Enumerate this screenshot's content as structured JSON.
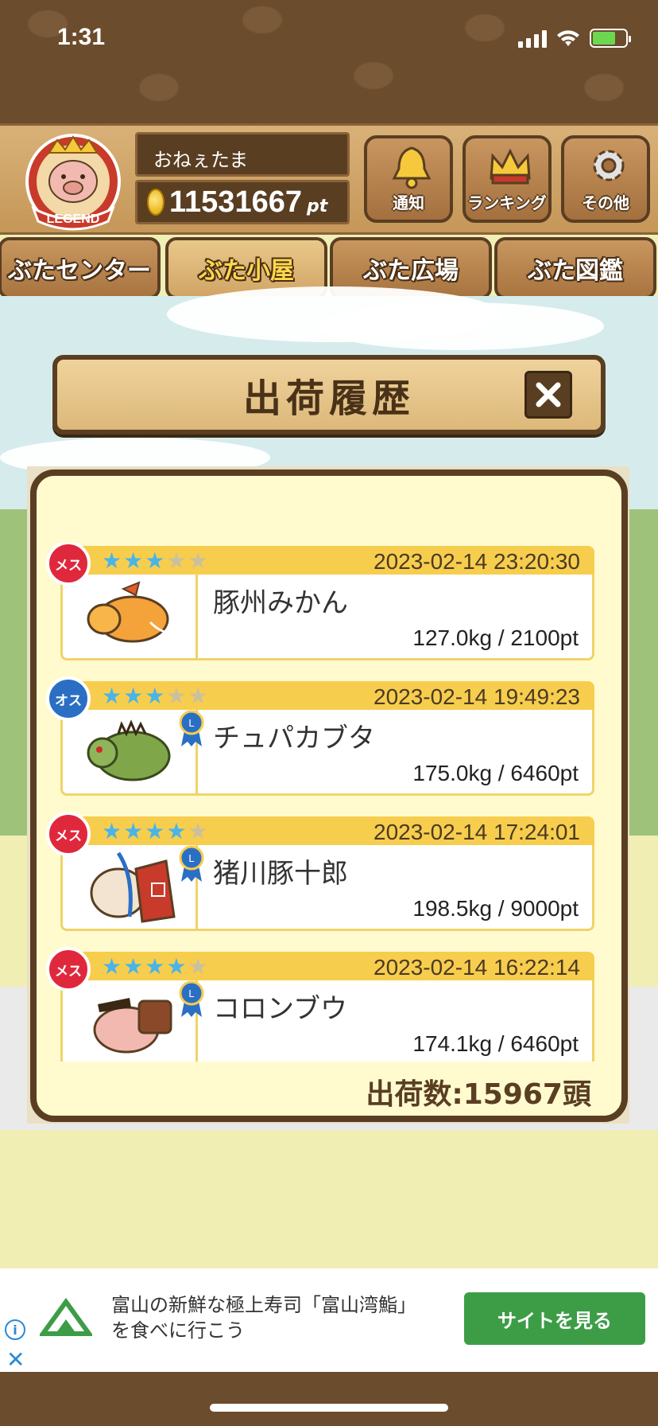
{
  "status": {
    "time": "1:31"
  },
  "player": {
    "name": "おねぇたま",
    "points": "11531667",
    "points_unit": "pt",
    "badge_text": "LEGEND"
  },
  "top_buttons": {
    "notice": "通知",
    "ranking": "ランキング",
    "other": "その他"
  },
  "tabs": [
    {
      "label": "ぶたセンター",
      "active": false
    },
    {
      "label": "ぶた小屋",
      "active": true
    },
    {
      "label": "ぶた広場",
      "active": false
    },
    {
      "label": "ぶた図鑑",
      "active": false
    }
  ],
  "dialog": {
    "title": "出荷履歴",
    "count_label": "出荷数:15967頭"
  },
  "records": [
    {
      "gender": "メス",
      "stars": 3,
      "max_stars": 5,
      "date": "2023-02-14 23:20:30",
      "name": "豚州みかん",
      "stats": "127.0kg / 2100pt",
      "ribbon": false
    },
    {
      "gender": "オス",
      "stars": 3,
      "max_stars": 5,
      "date": "2023-02-14 19:49:23",
      "name": "チュパカブタ",
      "stats": "175.0kg / 6460pt",
      "ribbon": true
    },
    {
      "gender": "メス",
      "stars": 4,
      "max_stars": 5,
      "date": "2023-02-14 17:24:01",
      "name": "猪川豚十郎",
      "stats": "198.5kg / 9000pt",
      "ribbon": true
    },
    {
      "gender": "メス",
      "stars": 4,
      "max_stars": 5,
      "date": "2023-02-14 16:22:14",
      "name": "コロンブウ",
      "stats": "174.1kg / 6460pt",
      "ribbon": true
    }
  ],
  "ad": {
    "text": "富山の新鮮な極上寿司「富山湾鮨」を食べに行こう",
    "button": "サイトを見る"
  },
  "colors": {
    "wood_dark": "#5a3e22",
    "header_yellow": "#f7cd4e",
    "star_on": "#4ab4e8",
    "female": "#e0283c",
    "male": "#2a6fc4",
    "ad_button": "#3d9d47"
  }
}
